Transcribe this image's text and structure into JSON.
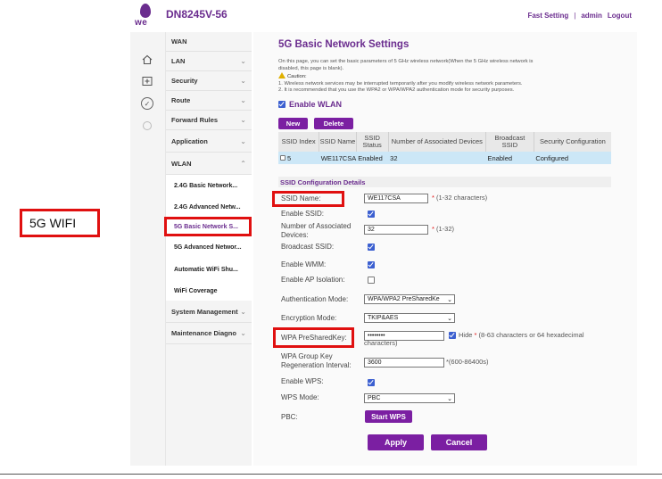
{
  "callout": {
    "label": "5G WIFI"
  },
  "header": {
    "logo_text": "we",
    "model": "DN8245V-56",
    "nav": {
      "fast_setting": "Fast Setting",
      "separator": "|",
      "user": "admin",
      "logout": "Logout"
    }
  },
  "sidebar": {
    "top": "WAN",
    "items": [
      "LAN",
      "Security",
      "Route",
      "Forward Rules",
      "Application",
      "WLAN"
    ],
    "wlan_sub": [
      "2.4G Basic Network...",
      "2.4G Advanced Netw...",
      "5G Basic Network S...",
      "5G Advanced Networ...",
      "Automatic WiFi Shu...",
      "WiFi Coverage"
    ],
    "bottom": [
      "System Management",
      "Maintenance Diagno"
    ]
  },
  "page": {
    "title": "5G Basic Network Settings",
    "desc_line1": "On this page, you can set the basic parameters of 5 GHz wireless network(When the 5 GHz wireless network is",
    "desc_line2": "disabled, this page is blank).",
    "caution": "Caution:",
    "caution1": "1. Wireless network services may be interrupted temporarily after you modify wireless network parameters.",
    "caution2": "2. It is recommended that you use the WPA2 or WPA/WPA2 authentication mode for security purposes.",
    "enable_wlan": "Enable WLAN",
    "btn_new": "New",
    "btn_delete": "Delete"
  },
  "ssid_table": {
    "headers": [
      "SSID Index",
      "SSID Name",
      "SSID Status",
      "Number of Associated Devices",
      "Broadcast SSID",
      "Security Configuration"
    ],
    "row": [
      "5",
      "WE117CSA",
      "Enabled",
      "32",
      "Enabled",
      "Configured"
    ]
  },
  "config": {
    "section_title": "SSID Configuration Details",
    "ssid_name_label": "SSID Name:",
    "ssid_name_value": "WE117CSA",
    "ssid_name_hint": "(1-32 characters)",
    "enable_ssid_label": "Enable SSID:",
    "num_devices_label": "Number of Associated Devices:",
    "num_devices_value": "32",
    "num_devices_hint": "(1-32)",
    "broadcast_label": "Broadcast SSID:",
    "wmm_label": "Enable WMM:",
    "ap_isolation_label": "Enable AP Isolation:",
    "auth_label": "Authentication Mode:",
    "auth_value": "WPA/WPA2 PreSharedKe",
    "enc_label": "Encryption Mode:",
    "enc_value": "TKIP&AES",
    "psk_label": "WPA PreSharedKey:",
    "psk_value": "••••••••",
    "psk_hide": "Hide",
    "psk_hint1": "(8-63 characters or 64 hexadecimal",
    "psk_hint2": "characters)",
    "group_key_label": "WPA Group Key Regeneration Interval:",
    "group_key_value": "3600",
    "group_key_hint": "*(600-86400s)",
    "wps_label": "Enable WPS:",
    "wps_mode_label": "WPS Mode:",
    "wps_mode_value": "PBC",
    "pbc_label": "PBC:",
    "start_wps": "Start WPS",
    "apply": "Apply",
    "cancel": "Cancel"
  },
  "colors": {
    "brand": "#6a2c8e",
    "button": "#7b1fa2",
    "highlight": "#e01010",
    "selected_row": "#cce7f7"
  }
}
